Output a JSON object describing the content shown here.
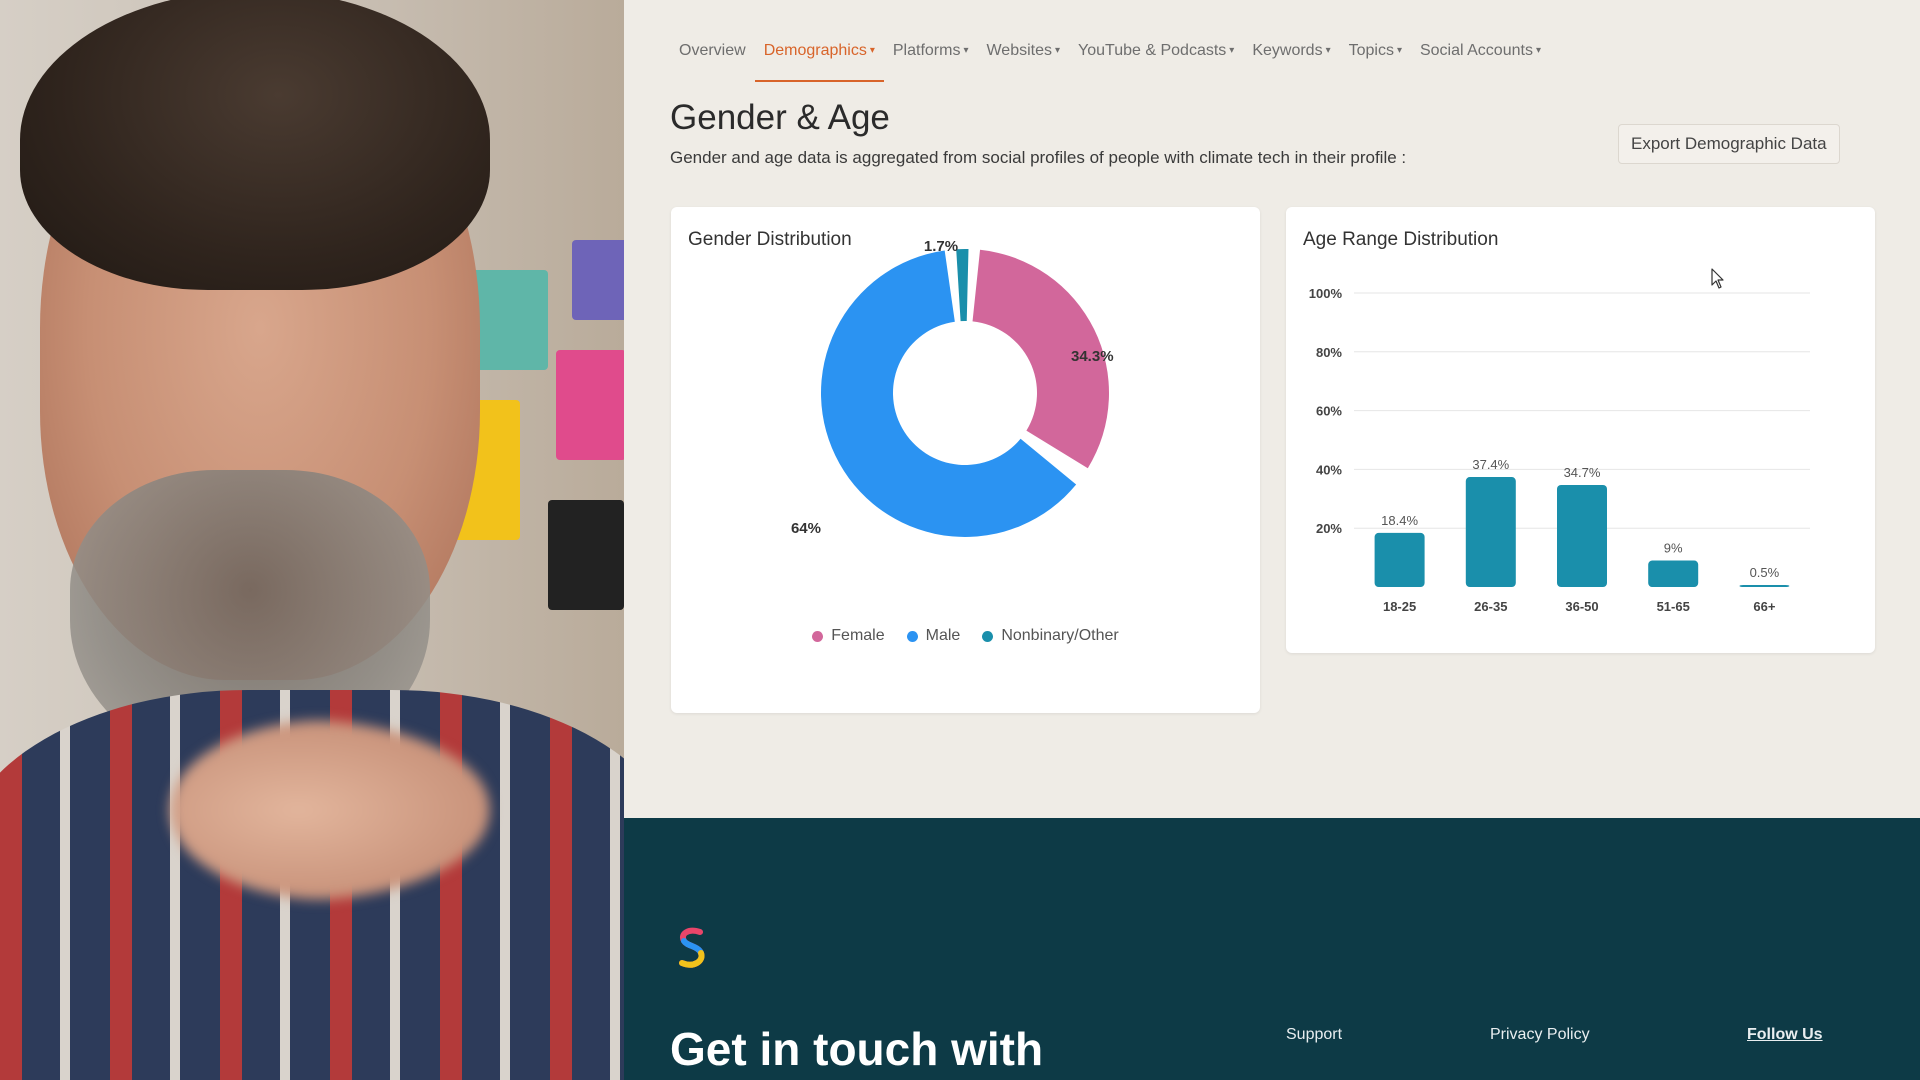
{
  "nav": {
    "items": [
      {
        "label": "Overview",
        "has_caret": false
      },
      {
        "label": "Demographics",
        "has_caret": true,
        "active": true
      },
      {
        "label": "Platforms",
        "has_caret": true
      },
      {
        "label": "Websites",
        "has_caret": true
      },
      {
        "label": "YouTube & Podcasts",
        "has_caret": true
      },
      {
        "label": "Keywords",
        "has_caret": true
      },
      {
        "label": "Topics",
        "has_caret": true
      },
      {
        "label": "Social Accounts",
        "has_caret": true
      }
    ],
    "caret_icon": "caret-down-icon"
  },
  "header": {
    "title": "Gender & Age",
    "description": "Gender and age data is aggregated from social profiles of people with climate tech in their profile :",
    "export_label": "Export Demographic Data"
  },
  "gender_card": {
    "title": "Gender Distribution"
  },
  "age_card": {
    "title": "Age Range Distribution"
  },
  "chart_data": [
    {
      "type": "pie",
      "title": "Gender Distribution",
      "categories": [
        "Female",
        "Male",
        "Nonbinary/Other"
      ],
      "values": [
        34.3,
        64,
        1.7
      ],
      "labels": [
        "34.3%",
        "64%",
        "1.7%"
      ],
      "colors": [
        "#d2679b",
        "#2b93f2",
        "#1a8fab"
      ],
      "legend": "bottom"
    },
    {
      "type": "bar",
      "title": "Age Range Distribution",
      "categories": [
        "18-25",
        "26-35",
        "36-50",
        "51-65",
        "66+"
      ],
      "values": [
        18.4,
        37.4,
        34.7,
        9,
        0.5
      ],
      "labels": [
        "18.4%",
        "37.4%",
        "34.7%",
        "9%",
        "0.5%"
      ],
      "yticks": [
        "20%",
        "40%",
        "60%",
        "80%",
        "100%"
      ],
      "ylim": [
        0,
        100
      ],
      "color": "#1a8fab",
      "grid": true
    }
  ],
  "footer": {
    "heading": "Get in touch with",
    "links": {
      "support": "Support",
      "privacy": "Privacy Policy",
      "follow": "Follow Us"
    },
    "logo_icon": "brand-s-logo"
  },
  "colors": {
    "accent": "#d8642a",
    "footer_bg": "#0d3a46"
  }
}
